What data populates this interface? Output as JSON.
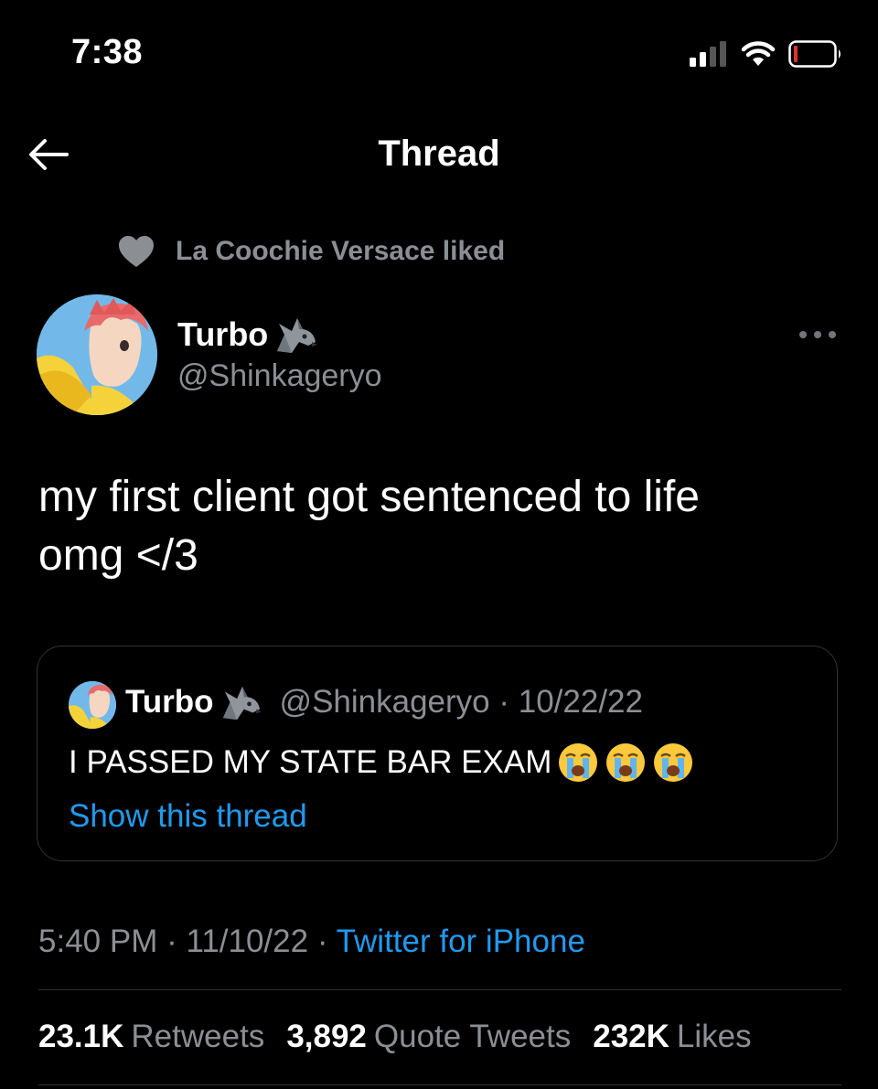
{
  "status_bar": {
    "time": "7:38"
  },
  "header": {
    "title": "Thread"
  },
  "social_context": {
    "text": "La Coochie Versace liked",
    "icon": "heart-icon"
  },
  "author": {
    "name": "Turbo",
    "name_emoji": "wolf",
    "handle": "@Shinkageryo"
  },
  "tweet": {
    "text": "my first client got sentenced to life\nomg </3"
  },
  "quoted_tweet": {
    "name": "Turbo",
    "name_emoji": "wolf",
    "meta": "@Shinkageryo · 10/22/22",
    "text": "I PASSED MY STATE BAR EXAM",
    "text_emoji": [
      "loudly-crying-face",
      "loudly-crying-face",
      "loudly-crying-face"
    ],
    "link": "Show this thread"
  },
  "timestamp": {
    "time_date": "5:40 PM · 11/10/22 · ",
    "source": "Twitter for iPhone"
  },
  "stats": {
    "retweets_count": "23.1K",
    "retweets_label": "Retweets",
    "quotes_count": "3,892",
    "quotes_label": "Quote Tweets",
    "likes_count": "232K",
    "likes_label": "Likes"
  },
  "colors": {
    "background": "#000000",
    "accent": "#1d9bf0",
    "secondary_text": "#8b8f94",
    "border": "#2f3336"
  }
}
